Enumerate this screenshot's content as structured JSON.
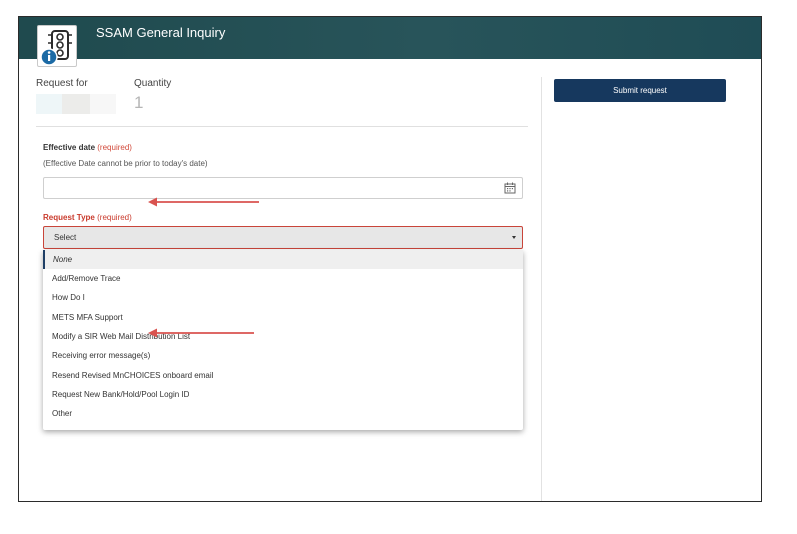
{
  "header": {
    "title": "SSAM General Inquiry",
    "logo_icon": "traffic-light-info-icon"
  },
  "request_for": {
    "label": "Request for"
  },
  "quantity": {
    "label": "Quantity",
    "value": "1"
  },
  "effective_date": {
    "label": "Effective date",
    "required_tag": "(required)",
    "hint": "(Effective Date cannot be prior to today's date)",
    "value": ""
  },
  "request_type": {
    "label": "Request Type",
    "required_tag": "(required)",
    "selected": "Select",
    "options": [
      "None",
      "Add/Remove Trace",
      "How Do I",
      "METS MFA Support",
      "Modify a SIR Web Mail Distribution List",
      "Receiving error message(s)",
      "Resend Revised MnCHOICES onboard email",
      "Request New Bank/Hold/Pool Login ID",
      "Other"
    ]
  },
  "submit": {
    "label": "Submit request"
  },
  "colors": {
    "header": "#1f4a4e",
    "submit": "#16385e",
    "required": "#d24a3b",
    "annotation_arrow": "#d9534f"
  }
}
